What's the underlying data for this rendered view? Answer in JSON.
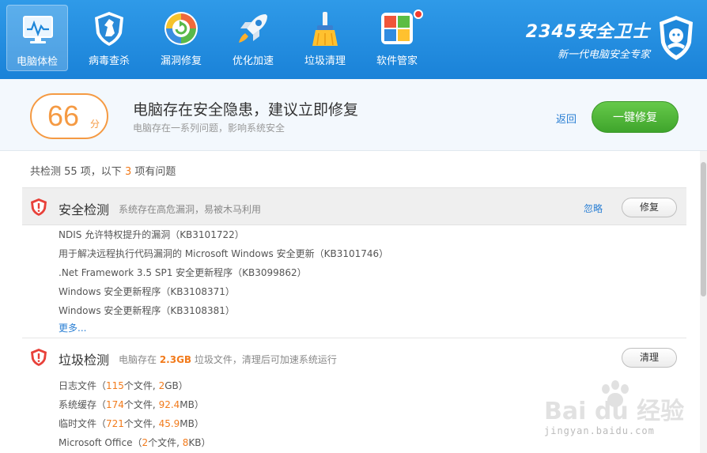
{
  "nav": {
    "items": [
      {
        "label": "电脑体检",
        "icon": "monitor-icon",
        "active": true
      },
      {
        "label": "病毒查杀",
        "icon": "shield-horse-icon",
        "active": false
      },
      {
        "label": "漏洞修复",
        "icon": "repair-circle-icon",
        "active": false
      },
      {
        "label": "优化加速",
        "icon": "rocket-icon",
        "active": false
      },
      {
        "label": "垃圾清理",
        "icon": "broom-icon",
        "active": false
      },
      {
        "label": "软件管家",
        "icon": "windows-grid-icon",
        "active": false
      }
    ],
    "brand_title": "2345安全卫士",
    "brand_subtitle": "新一代电脑安全专家"
  },
  "summary": {
    "score": "66",
    "score_unit": "分",
    "title": "电脑存在安全隐患，建议立即修复",
    "subtitle": "电脑存在一系列问题，影响系统安全",
    "back_label": "返回",
    "fix_all_label": "一键修复"
  },
  "results": {
    "prefix": "共检测 55 项，以下 ",
    "issue_count": "3",
    "suffix": " 项有问题"
  },
  "security": {
    "title": "安全检测",
    "desc": "系统存在高危漏洞，易被木马利用",
    "ignore_label": "忽略",
    "fix_label": "修复",
    "items": [
      "NDIS 允许特权提升的漏洞（KB3101722）",
      "用于解决远程执行代码漏洞的 Microsoft Windows 安全更新（KB3101746）",
      ".Net Framework 3.5 SP1 安全更新程序（KB3099862）",
      "Windows 安全更新程序（KB3108371）",
      "Windows 安全更新程序（KB3108381）"
    ],
    "more_label": "更多..."
  },
  "junk": {
    "title": "垃圾检测",
    "desc_prefix": "电脑存在 ",
    "size": "2.3GB",
    "desc_suffix": " 垃圾文件，清理后可加速系统运行",
    "clean_label": "清理",
    "items": [
      {
        "name": "日志文件（",
        "count": "115",
        "mid": "个文件, ",
        "size": "2",
        "tail": "GB）"
      },
      {
        "name": "系统缓存（",
        "count": "174",
        "mid": "个文件, ",
        "size": "92.4",
        "tail": "MB）"
      },
      {
        "name": "临时文件（",
        "count": "721",
        "mid": "个文件, ",
        "size": "45.9",
        "tail": "MB）"
      },
      {
        "name": "Microsoft Office（",
        "count": "2",
        "mid": "个文件, ",
        "size": "8",
        "tail": "KB）"
      }
    ]
  },
  "watermark": {
    "text": "Bai du 经验",
    "url": "jingyan.baidu.com"
  },
  "colors": {
    "topbar": "#1f8ce0",
    "score_orange": "#f59a43",
    "highlight": "#f27b1c",
    "link": "#2a7fd4",
    "green_button": "#4cb535",
    "danger_red": "#e8413a"
  }
}
